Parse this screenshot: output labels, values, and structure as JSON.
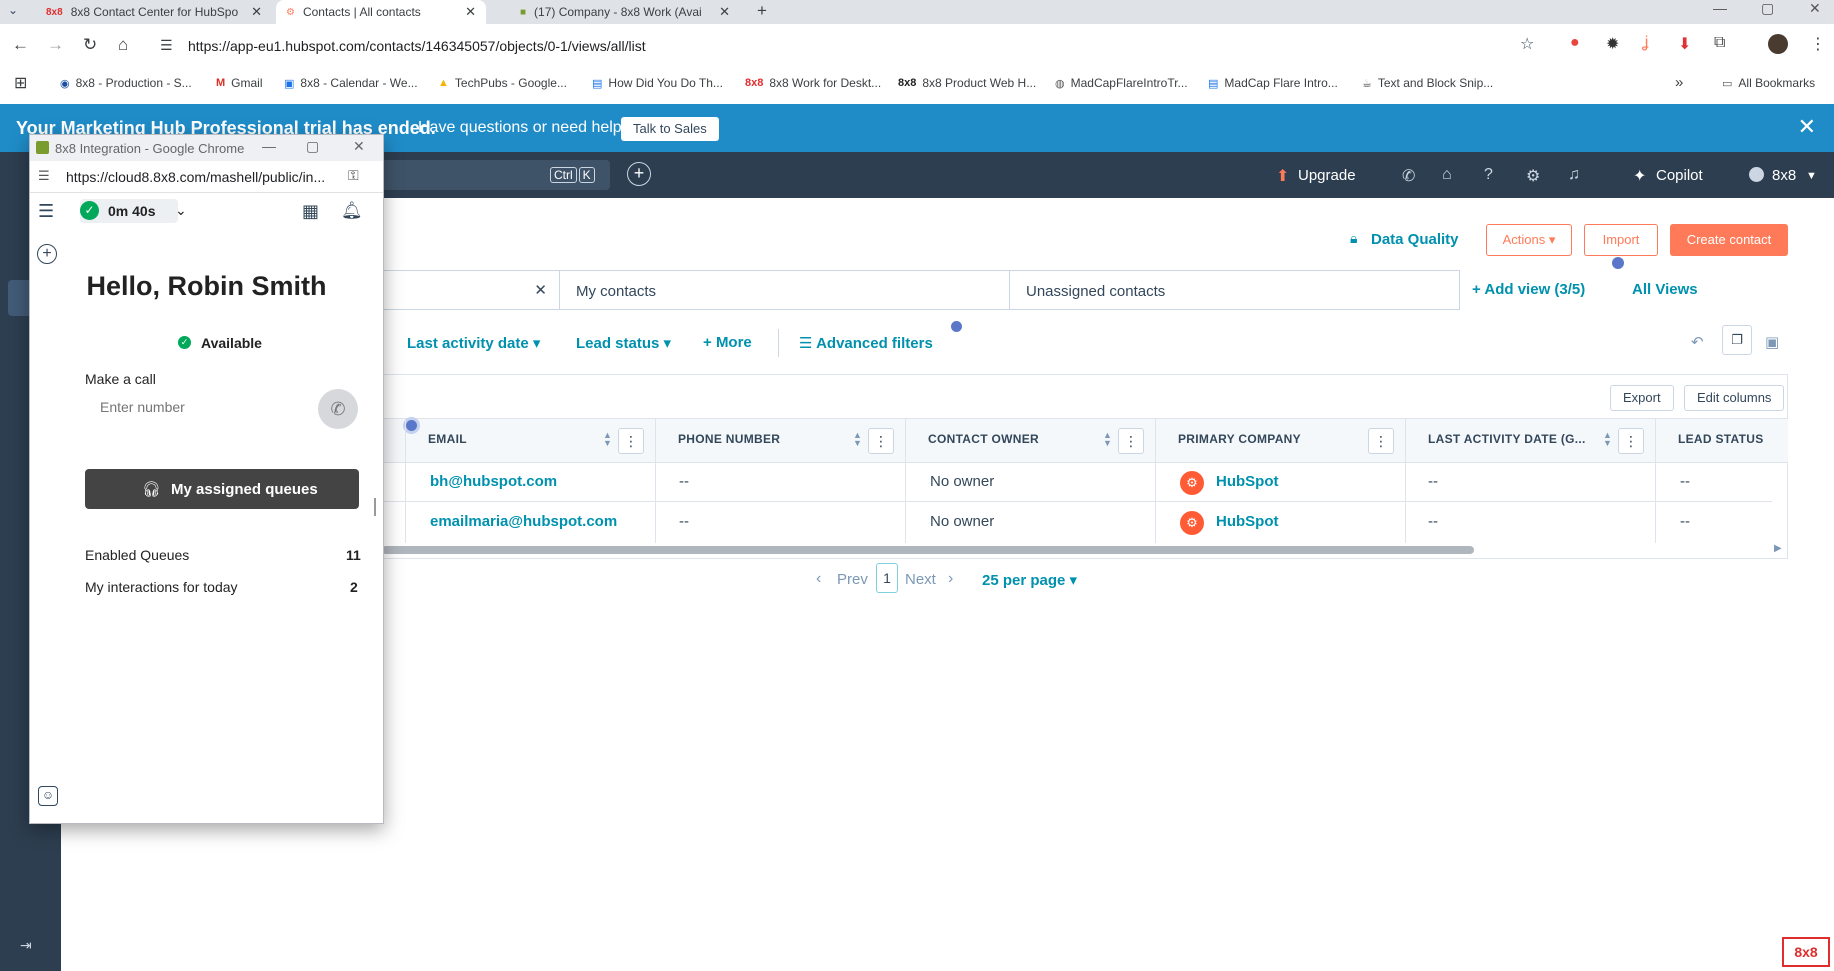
{
  "browser": {
    "tabs": [
      {
        "label": "8x8 Contact Center for HubSpo",
        "favicon": "8x8"
      },
      {
        "label": "Contacts | All contacts",
        "favicon": "hubspot"
      },
      {
        "label": "(17) Company - 8x8 Work (Avai",
        "favicon": "8x8-work"
      }
    ],
    "url": "https://app-eu1.hubspot.com/contacts/146345057/objects/0-1/views/all/list",
    "bookmarks": [
      "8x8 - Production - S...",
      "Gmail",
      "8x8 - Calendar - We...",
      "TechPubs - Google...",
      "How Did You Do Th...",
      "8x8 Work for Deskt...",
      "8x8 Product Web H...",
      "MadCapFlareIntroTr...",
      "MadCap Flare Intro...",
      "Text and Block Snip..."
    ],
    "all_bookmarks": "All Bookmarks",
    "more_bookmarks": "»"
  },
  "banner": {
    "title": "Your Marketing Hub Professional trial has ended.",
    "text": "Have questions or need help?",
    "button": "Talk to Sales"
  },
  "hubspot_nav": {
    "shortcut_ctrl": "Ctrl",
    "shortcut_key": "K",
    "upgrade": "Upgrade",
    "copilot": "Copilot",
    "account": "8x8"
  },
  "header": {
    "data_quality": "Data Quality",
    "actions": "Actions ▾",
    "import": "Import",
    "create": "Create contact"
  },
  "views": {
    "tabs": [
      "My contacts",
      "Unassigned contacts"
    ],
    "add_view": "Add view (3/5)",
    "all_views": "All Views"
  },
  "filters": {
    "last_activity": "Last activity date ▾",
    "lead_status": "Lead status ▾",
    "more": "More",
    "advanced": "Advanced filters"
  },
  "table": {
    "export": "Export",
    "edit_columns": "Edit columns",
    "columns": [
      "EMAIL",
      "PHONE NUMBER",
      "CONTACT OWNER",
      "PRIMARY COMPANY",
      "LAST ACTIVITY DATE (G...",
      "LEAD STATUS"
    ],
    "rows": [
      {
        "email": "bh@hubspot.com",
        "phone": "--",
        "owner": "No owner",
        "company": "HubSpot",
        "last_activity": "--",
        "lead_status": "--"
      },
      {
        "email": "emailmaria@hubspot.com",
        "phone": "--",
        "owner": "No owner",
        "company": "HubSpot",
        "last_activity": "--",
        "lead_status": "--"
      }
    ]
  },
  "pagination": {
    "prev": "Prev",
    "page": "1",
    "next": "Next",
    "per_page": "25 per page ▾"
  },
  "popup": {
    "window_title": "8x8 Integration - Google Chrome",
    "url": "https://cloud8.8x8.com/mashell/public/in...",
    "timer": "0m 40s",
    "greeting": "Hello, Robin Smith",
    "status": "Available",
    "make_call": "Make a call",
    "number_placeholder": "Enter number",
    "queues_button": "My assigned queues",
    "stats": [
      {
        "label": "Enabled Queues",
        "value": "11"
      },
      {
        "label": "My interactions for today",
        "value": "2"
      }
    ]
  },
  "brand_badge": "8x8",
  "colors": {
    "hubspot_orange": "#ff7a59",
    "hubspot_link": "#0091ae",
    "nav_dark": "#2d3e50",
    "banner_blue": "#1f8cc8",
    "status_green": "#00a85a"
  }
}
